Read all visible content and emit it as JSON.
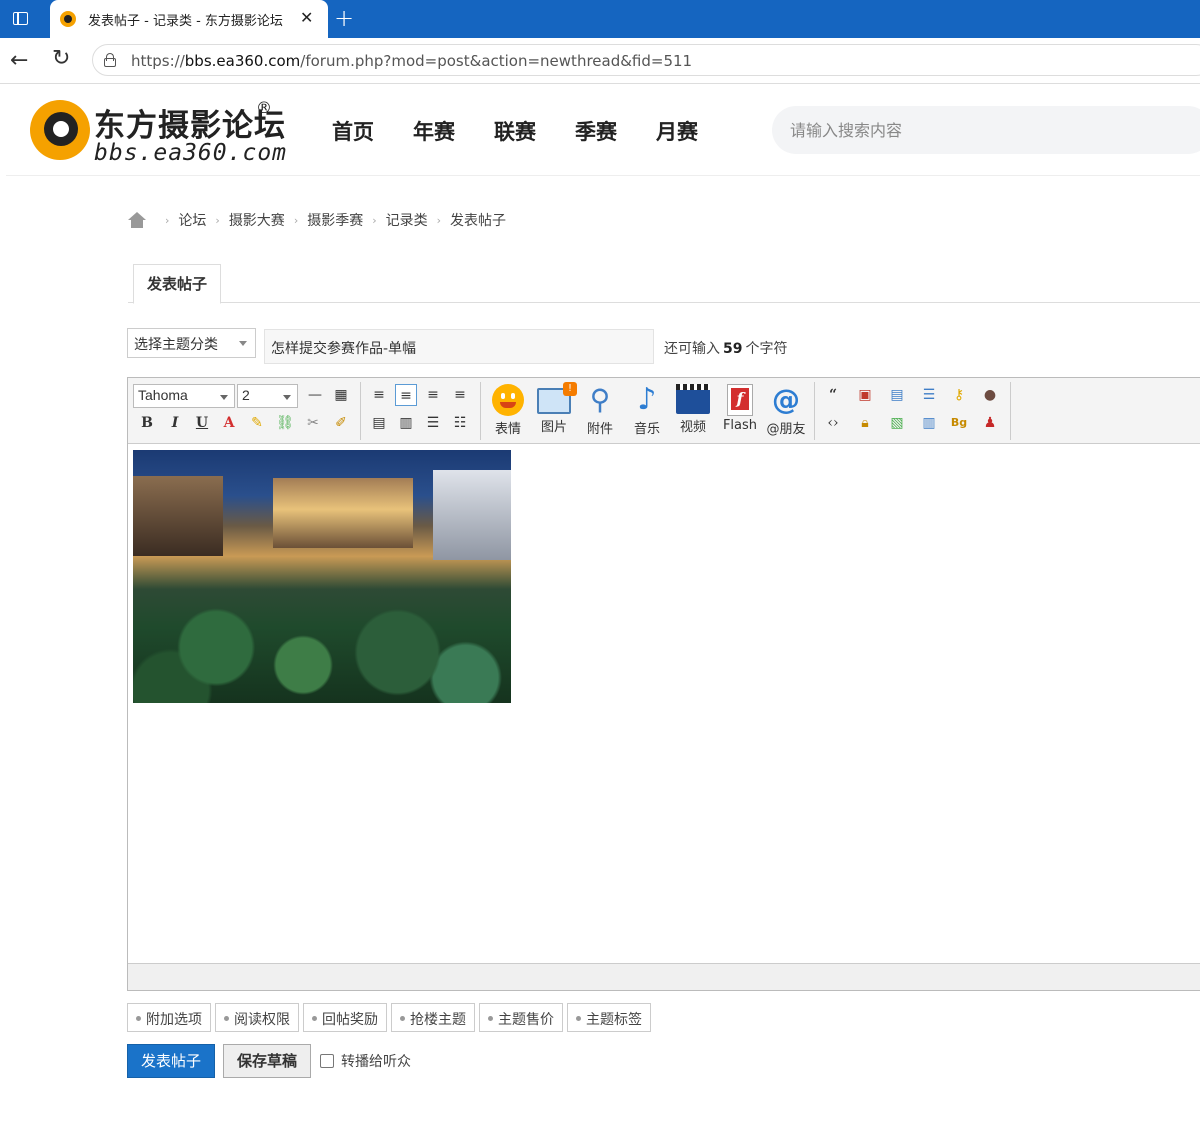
{
  "browser": {
    "tab_title": "发表帖子 - 记录类 - 东方摄影论坛",
    "url_scheme": "https://",
    "url_host": "bbs.ea360.com",
    "url_path": "/forum.php?mod=post&action=newthread&fid=511"
  },
  "site": {
    "logo_title": "东方摄影论坛",
    "logo_reg": "®",
    "logo_sub": "bbs.ea360.com",
    "nav": [
      "首页",
      "年赛",
      "联赛",
      "季赛",
      "月赛"
    ],
    "search_placeholder": "请输入搜索内容"
  },
  "breadcrumb": [
    "论坛",
    "摄影大赛",
    "摄影季赛",
    "记录类",
    "发表帖子"
  ],
  "breadcrumb_sep": "›",
  "tab_label": "发表帖子",
  "subject": {
    "type_select": "选择主题分类",
    "title_value": "怎样提交参赛作品-单幅",
    "remaining_prefix": "还可输入",
    "remaining_count": "59",
    "remaining_suffix": "个字符"
  },
  "editor": {
    "font": "Tahoma",
    "size": "2",
    "small_buttons": [
      "B",
      "I",
      "U",
      "A"
    ],
    "big_buttons": [
      "表情",
      "图片",
      "附件",
      "音乐",
      "视频",
      "Flash",
      "@朋友"
    ]
  },
  "options": [
    "附加选项",
    "阅读权限",
    "回帖奖励",
    "抢楼主题",
    "主题售价",
    "主题标签"
  ],
  "actions": {
    "post": "发表帖子",
    "draft": "保存草稿",
    "broadcast": "转播给听众"
  }
}
